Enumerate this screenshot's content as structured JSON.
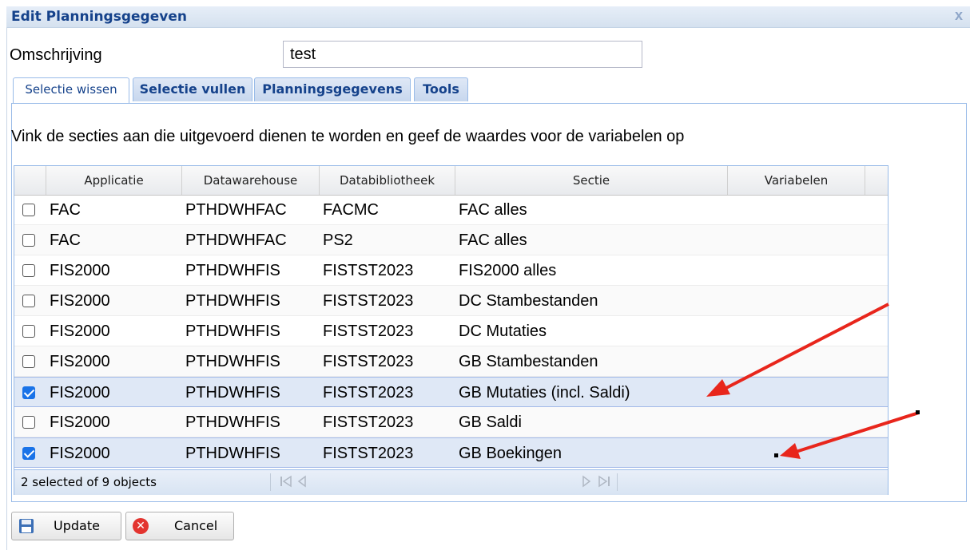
{
  "window": {
    "title": "Edit Planningsgegeven",
    "close_glyph": "x"
  },
  "form": {
    "omschrijving_label": "Omschrijving",
    "omschrijving_value": "test"
  },
  "tabs": [
    {
      "label": "Selectie wissen",
      "active": true
    },
    {
      "label": "Selectie vullen",
      "active": false
    },
    {
      "label": "Planningsgegevens",
      "active": false
    },
    {
      "label": "Tools",
      "active": false
    }
  ],
  "instruction": "Vink de secties aan die uitgevoerd dienen te worden en geef de waardes voor de variabelen op",
  "grid": {
    "columns": [
      "Applicatie",
      "Datawarehouse",
      "Databibliotheek",
      "Sectie",
      "Variabelen"
    ],
    "rows": [
      {
        "checked": false,
        "applicatie": "FAC",
        "datawarehouse": "PTHDWHFAC",
        "databibliotheek": "FACMC",
        "sectie": "FAC alles",
        "variabelen": ""
      },
      {
        "checked": false,
        "applicatie": "FAC",
        "datawarehouse": "PTHDWHFAC",
        "databibliotheek": "PS2",
        "sectie": "FAC alles",
        "variabelen": ""
      },
      {
        "checked": false,
        "applicatie": "FIS2000",
        "datawarehouse": "PTHDWHFIS",
        "databibliotheek": "FISTST2023",
        "sectie": "FIS2000 alles",
        "variabelen": ""
      },
      {
        "checked": false,
        "applicatie": "FIS2000",
        "datawarehouse": "PTHDWHFIS",
        "databibliotheek": "FISTST2023",
        "sectie": "DC Stambestanden",
        "variabelen": ""
      },
      {
        "checked": false,
        "applicatie": "FIS2000",
        "datawarehouse": "PTHDWHFIS",
        "databibliotheek": "FISTST2023",
        "sectie": "DC Mutaties",
        "variabelen": ""
      },
      {
        "checked": false,
        "applicatie": "FIS2000",
        "datawarehouse": "PTHDWHFIS",
        "databibliotheek": "FISTST2023",
        "sectie": "GB Stambestanden",
        "variabelen": ""
      },
      {
        "checked": true,
        "applicatie": "FIS2000",
        "datawarehouse": "PTHDWHFIS",
        "databibliotheek": "FISTST2023",
        "sectie": "GB Mutaties (incl. Saldi)",
        "variabelen": ""
      },
      {
        "checked": false,
        "applicatie": "FIS2000",
        "datawarehouse": "PTHDWHFIS",
        "databibliotheek": "FISTST2023",
        "sectie": "GB Saldi",
        "variabelen": ""
      },
      {
        "checked": true,
        "applicatie": "FIS2000",
        "datawarehouse": "PTHDWHFIS",
        "databibliotheek": "FISTST2023",
        "sectie": "GB Boekingen",
        "variabelen": ""
      }
    ],
    "footer": {
      "count_text": "2 selected of 9 objects"
    }
  },
  "buttons": {
    "update_label": "Update",
    "cancel_label": "Cancel"
  },
  "colors": {
    "accent": "#15428b",
    "selected_row": "#dfe8f6",
    "checkbox": "#1a73e8",
    "annotation_arrow": "#e8261c"
  },
  "icons": [
    "close-icon",
    "first-page-icon",
    "prev-page-icon",
    "next-page-icon",
    "last-page-icon",
    "save-icon",
    "cancel-icon"
  ]
}
